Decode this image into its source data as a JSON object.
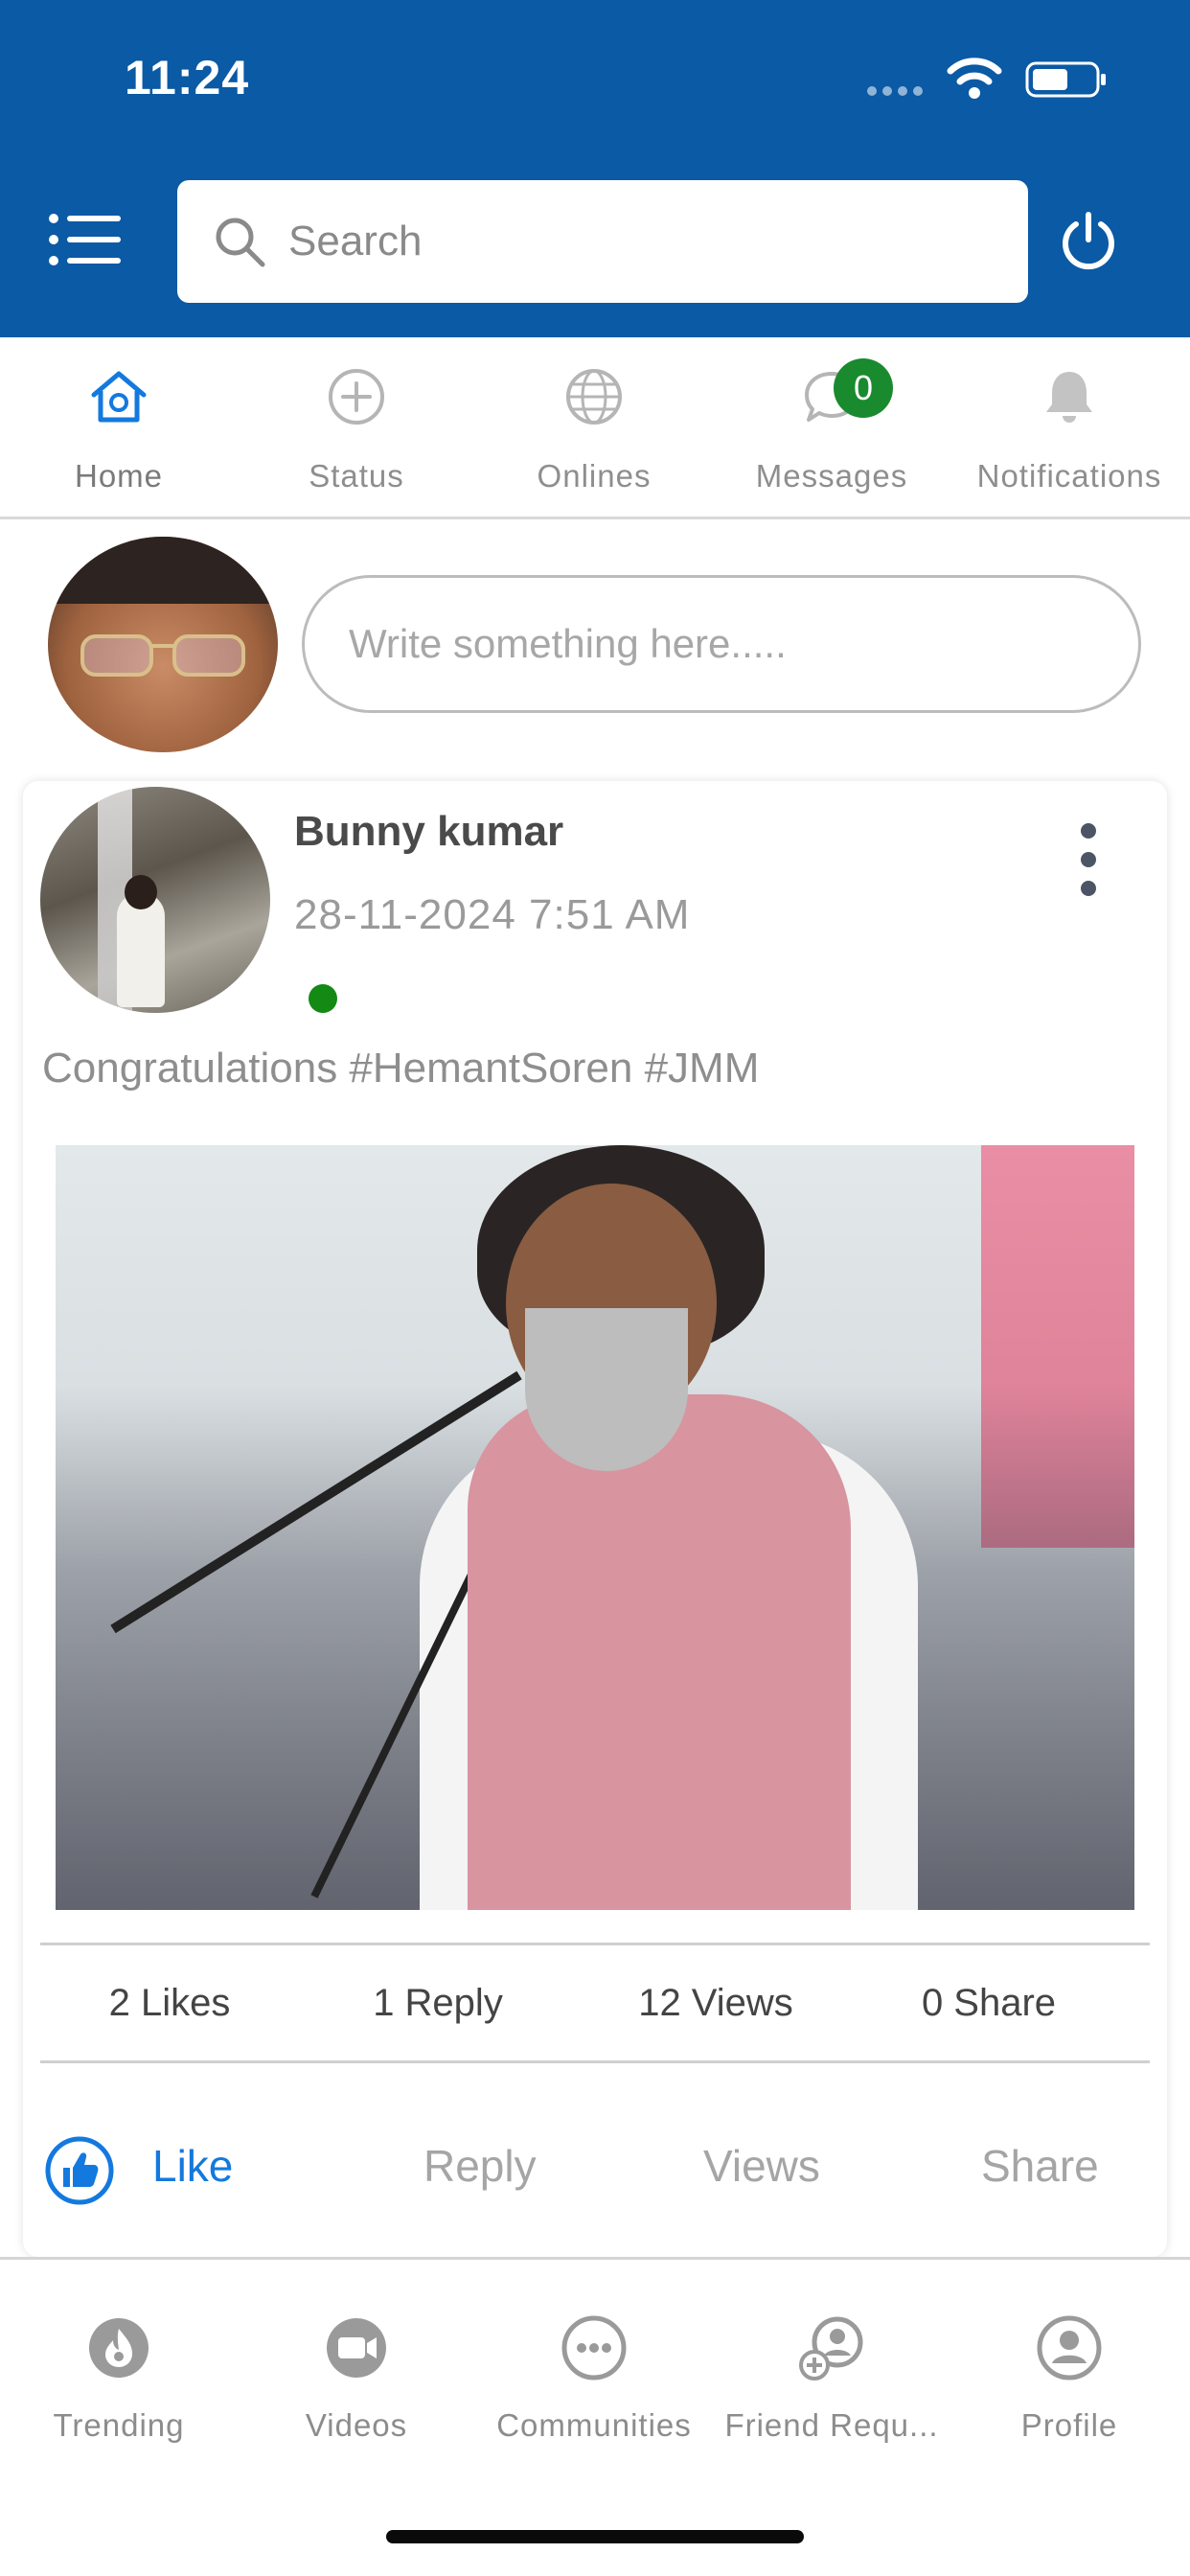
{
  "status_bar": {
    "time": "11:24"
  },
  "header": {
    "search_placeholder": "Search",
    "icons": [
      "menu-icon",
      "search-icon",
      "power-icon"
    ]
  },
  "tabs": [
    {
      "label": "Home",
      "icon": "home-icon",
      "active": true
    },
    {
      "label": "Status",
      "icon": "plus-circle-icon"
    },
    {
      "label": "Onlines",
      "icon": "globe-icon"
    },
    {
      "label": "Messages",
      "icon": "chat-icon",
      "badge": "0"
    },
    {
      "label": "Notifications",
      "icon": "bell-icon"
    }
  ],
  "composer": {
    "placeholder": "Write something here....."
  },
  "post": {
    "author": "Bunny kumar",
    "timestamp": "28-11-2024 7:51 AM",
    "text": "Congratulations #HemantSoren #JMM",
    "stats": {
      "likes": "2 Likes",
      "replies": "1 Reply",
      "views": "12 Views",
      "shares": "0 Share"
    },
    "actions": {
      "like": "Like",
      "reply": "Reply",
      "views": "Views",
      "share": "Share"
    }
  },
  "bottom_nav": [
    {
      "label": "Trending",
      "icon": "fire-icon"
    },
    {
      "label": "Videos",
      "icon": "video-icon"
    },
    {
      "label": "Communities",
      "icon": "more-circle-icon"
    },
    {
      "label": "Friend Requ...",
      "icon": "add-friend-icon"
    },
    {
      "label": "Profile",
      "icon": "user-circle-icon"
    }
  ],
  "colors": {
    "header_bg": "#0a5aa5",
    "accent": "#1479de",
    "online": "#138a13",
    "badge": "#1a8a2e"
  }
}
